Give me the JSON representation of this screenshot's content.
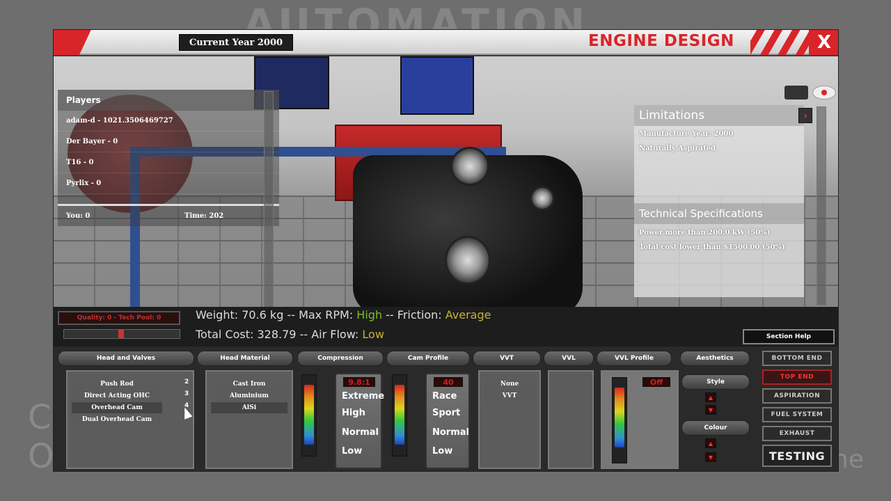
{
  "background": {
    "logo_text": "AUTOMATION",
    "left_fragment_1": "C",
    "left_fragment_2": "O",
    "right_fragment": "ne"
  },
  "header": {
    "current_year": "Current Year 2000",
    "title": "ENGINE DESIGN",
    "close": "X"
  },
  "players": {
    "title": "Players",
    "rows": [
      "adam-d - 1021.3506469727",
      "Der Bayer - 0",
      "T16 - 0",
      "Pyrlix - 0"
    ],
    "you": "You: 0",
    "time": "Time: 202"
  },
  "limitations": {
    "title": "Limitations",
    "items": [
      "Manufacture Year: 2000",
      "Naturally Aspirated"
    ],
    "tech_title": "Technical Specifications",
    "tech_items": [
      "Power more than 200.0 kW (50%)",
      "Total cost lower than $1500.00 (50%)"
    ],
    "arrow": "›"
  },
  "stats": {
    "quality": "Quality: 0 - Tech Pool: 0",
    "weight_prefix": "Weight: 70.6 kg -- Max RPM: ",
    "max_rpm": "High",
    "friction_prefix": " -- Friction: ",
    "friction": "Average",
    "cost_prefix": "Total Cost: 328.79 -- Air Flow: ",
    "air_flow": "Low",
    "section_help": "Section Help"
  },
  "sections": {
    "head_valves": "Head and Valves",
    "head_material": "Head Material",
    "compression": "Compression",
    "cam_profile": "Cam Profile",
    "vvt": "VVT",
    "vvl": "VVL",
    "vvl_profile": "VVL Profile",
    "aesthetics": "Aesthetics"
  },
  "head_valves": {
    "options": [
      "Push Rod",
      "Direct Acting OHC",
      "Overhead Cam",
      "Dual Overhead Cam"
    ],
    "numbers": [
      "2",
      "3",
      "4"
    ]
  },
  "head_material": {
    "options": [
      "Cast Iron",
      "Aluminium",
      "AlSi"
    ]
  },
  "compression": {
    "display": "9.8:1",
    "options": [
      "Extreme",
      "High",
      "Normal",
      "Low"
    ]
  },
  "cam_profile": {
    "display": "40",
    "options": [
      "Race",
      "Sport",
      "Normal",
      "Low"
    ]
  },
  "vvt": {
    "options": [
      "None",
      "VVT"
    ]
  },
  "vvl_profile": {
    "display": "Off"
  },
  "aesthetics": {
    "style": "Style",
    "colour": "Colour"
  },
  "nav": {
    "bottom_end": "BOTTOM END",
    "top_end": "TOP END",
    "aspiration": "ASPIRATION",
    "fuel_system": "FUEL SYSTEM",
    "exhaust": "EXHAUST",
    "testing": "TESTING"
  },
  "colors": {
    "accent": "#d9252a",
    "value_green": "#7fbf2a",
    "value_yellow": "#c8b23a"
  }
}
